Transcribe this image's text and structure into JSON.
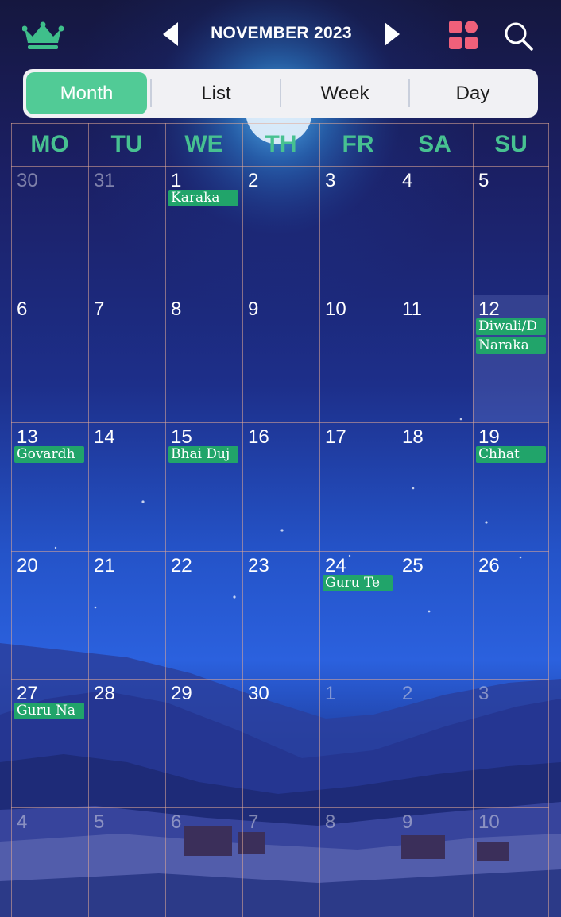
{
  "header": {
    "title": "NOVEMBER 2023",
    "icons": {
      "premium": "crown-icon",
      "prev": "triangle-left-icon",
      "next": "triangle-right-icon",
      "apps": "apps-grid-icon",
      "search": "search-icon"
    },
    "colors": {
      "accent_green": "#51cb96",
      "event_green": "#21a46a",
      "apps_red": "#f0607a",
      "crown_green": "#3fbf8b"
    }
  },
  "view_tabs": {
    "items": [
      {
        "label": "Month",
        "active": true
      },
      {
        "label": "List",
        "active": false
      },
      {
        "label": "Week",
        "active": false
      },
      {
        "label": "Day",
        "active": false
      }
    ]
  },
  "calendar": {
    "weekdays": [
      "MO",
      "TU",
      "WE",
      "TH",
      "FR",
      "SA",
      "SU"
    ],
    "weeks": [
      [
        {
          "day": "30",
          "other": true,
          "events": []
        },
        {
          "day": "31",
          "other": true,
          "events": []
        },
        {
          "day": "1",
          "other": false,
          "events": [
            "Karaka"
          ]
        },
        {
          "day": "2",
          "other": false,
          "events": []
        },
        {
          "day": "3",
          "other": false,
          "events": []
        },
        {
          "day": "4",
          "other": false,
          "events": []
        },
        {
          "day": "5",
          "other": false,
          "events": []
        }
      ],
      [
        {
          "day": "6",
          "other": false,
          "events": []
        },
        {
          "day": "7",
          "other": false,
          "events": []
        },
        {
          "day": "8",
          "other": false,
          "events": []
        },
        {
          "day": "9",
          "other": false,
          "events": []
        },
        {
          "day": "10",
          "other": false,
          "events": []
        },
        {
          "day": "11",
          "other": false,
          "events": []
        },
        {
          "day": "12",
          "other": false,
          "today": true,
          "events": [
            "Diwali/D",
            "Naraka"
          ]
        }
      ],
      [
        {
          "day": "13",
          "other": false,
          "events": [
            "Govardh"
          ]
        },
        {
          "day": "14",
          "other": false,
          "events": []
        },
        {
          "day": "15",
          "other": false,
          "events": [
            "Bhai Duj"
          ]
        },
        {
          "day": "16",
          "other": false,
          "events": []
        },
        {
          "day": "17",
          "other": false,
          "events": []
        },
        {
          "day": "18",
          "other": false,
          "events": []
        },
        {
          "day": "19",
          "other": false,
          "events": [
            "Chhat"
          ]
        }
      ],
      [
        {
          "day": "20",
          "other": false,
          "events": []
        },
        {
          "day": "21",
          "other": false,
          "events": []
        },
        {
          "day": "22",
          "other": false,
          "events": []
        },
        {
          "day": "23",
          "other": false,
          "events": []
        },
        {
          "day": "24",
          "other": false,
          "events": [
            "Guru Te"
          ]
        },
        {
          "day": "25",
          "other": false,
          "events": []
        },
        {
          "day": "26",
          "other": false,
          "events": []
        }
      ],
      [
        {
          "day": "27",
          "other": false,
          "events": [
            "Guru Na"
          ]
        },
        {
          "day": "28",
          "other": false,
          "events": []
        },
        {
          "day": "29",
          "other": false,
          "events": []
        },
        {
          "day": "30",
          "other": false,
          "events": []
        },
        {
          "day": "1",
          "other": true,
          "events": []
        },
        {
          "day": "2",
          "other": true,
          "events": []
        },
        {
          "day": "3",
          "other": true,
          "events": []
        }
      ],
      [
        {
          "day": "4",
          "other": true,
          "events": []
        },
        {
          "day": "5",
          "other": true,
          "events": []
        },
        {
          "day": "6",
          "other": true,
          "events": []
        },
        {
          "day": "7",
          "other": true,
          "events": []
        },
        {
          "day": "8",
          "other": true,
          "events": []
        },
        {
          "day": "9",
          "other": true,
          "events": []
        },
        {
          "day": "10",
          "other": true,
          "events": []
        }
      ]
    ]
  }
}
